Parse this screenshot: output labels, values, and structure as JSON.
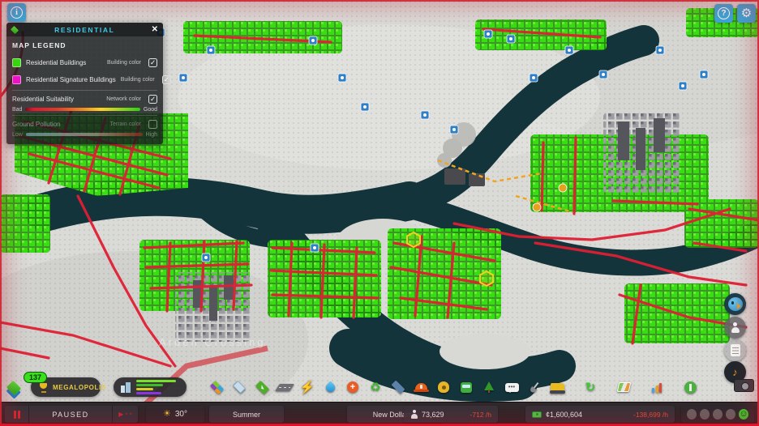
{
  "map": {
    "district_label": "Arden Crossing"
  },
  "glyphs": {
    "info": "i",
    "help": "?",
    "gear": "⚙",
    "close": "✕",
    "check": "✓",
    "sun": "☀",
    "bolt": "⚡",
    "plus": "+",
    "recycle": "♻",
    "rotate": "↻",
    "note": "♪",
    "smile": "☺",
    "dots": "•••",
    "play": "▶",
    "dot": "•",
    "mountain": "▲"
  },
  "legend": {
    "title": "RESIDENTIAL",
    "section_title": "MAP LEGEND",
    "items": [
      {
        "label": "Residential Buildings",
        "type_label": "Building color",
        "swatch_color": "#2fe10d",
        "checked": true
      },
      {
        "label": "Residential Signature Buildings",
        "type_label": "Building color",
        "swatch_color": "#ee13ce",
        "checked": true
      }
    ],
    "suitability": {
      "label": "Residential Suitability",
      "type_label": "Network color",
      "low_label": "Bad",
      "high_label": "Good",
      "checked": true,
      "gradient": [
        "#7a0c1c",
        "#e0192c",
        "#ef8c1e",
        "#ffd321",
        "#28d40e"
      ]
    },
    "pollution": {
      "label": "Ground Pollution",
      "type_label": "Terrain color",
      "low_label": "Low",
      "high_label": "High",
      "checked": false,
      "gradient": [
        "#9fd2ec",
        "#d8c8b4",
        "#bf2f25"
      ]
    }
  },
  "progression": {
    "milestone_level": "137",
    "milestone_name": "MEGALOPOLIS"
  },
  "demand": {
    "bars": [
      {
        "name": "residential",
        "color": "#76e32a",
        "value": 92
      },
      {
        "name": "commercial",
        "color": "#3dbd20",
        "value": 62
      },
      {
        "name": "industrial",
        "color": "#d8cb25",
        "value": 40
      },
      {
        "name": "office",
        "color": "#8a35e0",
        "value": 58
      }
    ]
  },
  "toolbar": {
    "items": [
      "zones",
      "areas",
      "terrain",
      "roads",
      "electricity",
      "water",
      "healthcare",
      "garbage",
      "education",
      "fire-rescue",
      "police",
      "transportation",
      "parks-recreation",
      "communications",
      "landscaping",
      "bulldozer",
      "economy",
      "info-views",
      "statistics",
      "progression",
      "photo-mode"
    ]
  },
  "side_buttons": [
    "chirper",
    "citizen-info",
    "journal",
    "radio"
  ],
  "status": {
    "paused_label": "PAUSED",
    "temperature": "30°",
    "season": "Summer",
    "city_name": "New Dollarton",
    "population": "73,629",
    "population_rate": "-712 /h",
    "money": "¢1,600,604",
    "money_rate": "-138,699 /h"
  }
}
